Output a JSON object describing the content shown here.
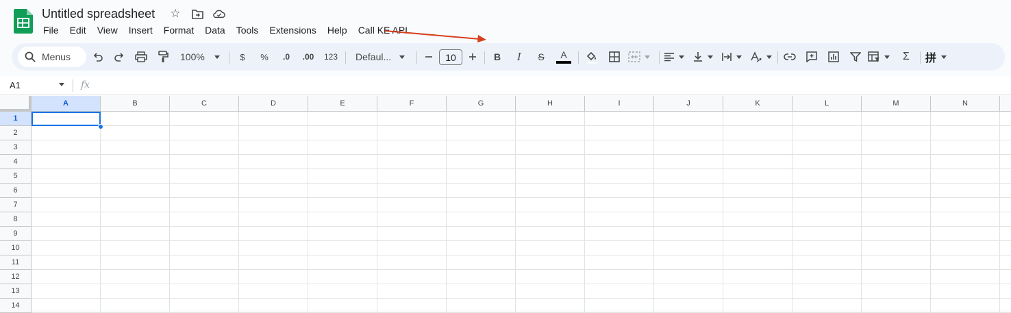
{
  "doc": {
    "title": "Untitled spreadsheet"
  },
  "menu": [
    "File",
    "Edit",
    "View",
    "Insert",
    "Format",
    "Data",
    "Tools",
    "Extensions",
    "Help",
    "Call KE API"
  ],
  "toolbar": {
    "search_label": "Menus",
    "zoom": "100%",
    "currency": "$",
    "percent": "%",
    "dec_decrease": ".0",
    "dec_increase": ".00",
    "number_format": "123",
    "font": "Defaul...",
    "font_size": "10",
    "text_color": "#000000",
    "accent": "#1a73e8"
  },
  "formula_bar": {
    "name_box": "A1",
    "fx": "fx"
  },
  "columns": [
    "A",
    "B",
    "C",
    "D",
    "E",
    "F",
    "G",
    "H",
    "I",
    "J",
    "K",
    "L",
    "M",
    "N"
  ],
  "rows": [
    "1",
    "2",
    "3",
    "4",
    "5",
    "6",
    "7",
    "8",
    "9",
    "10",
    "11",
    "12",
    "13",
    "14"
  ],
  "selection": {
    "cell": "A1",
    "col_index": 0,
    "row_index": 0
  },
  "annotation": {
    "color": "#d7401e"
  }
}
